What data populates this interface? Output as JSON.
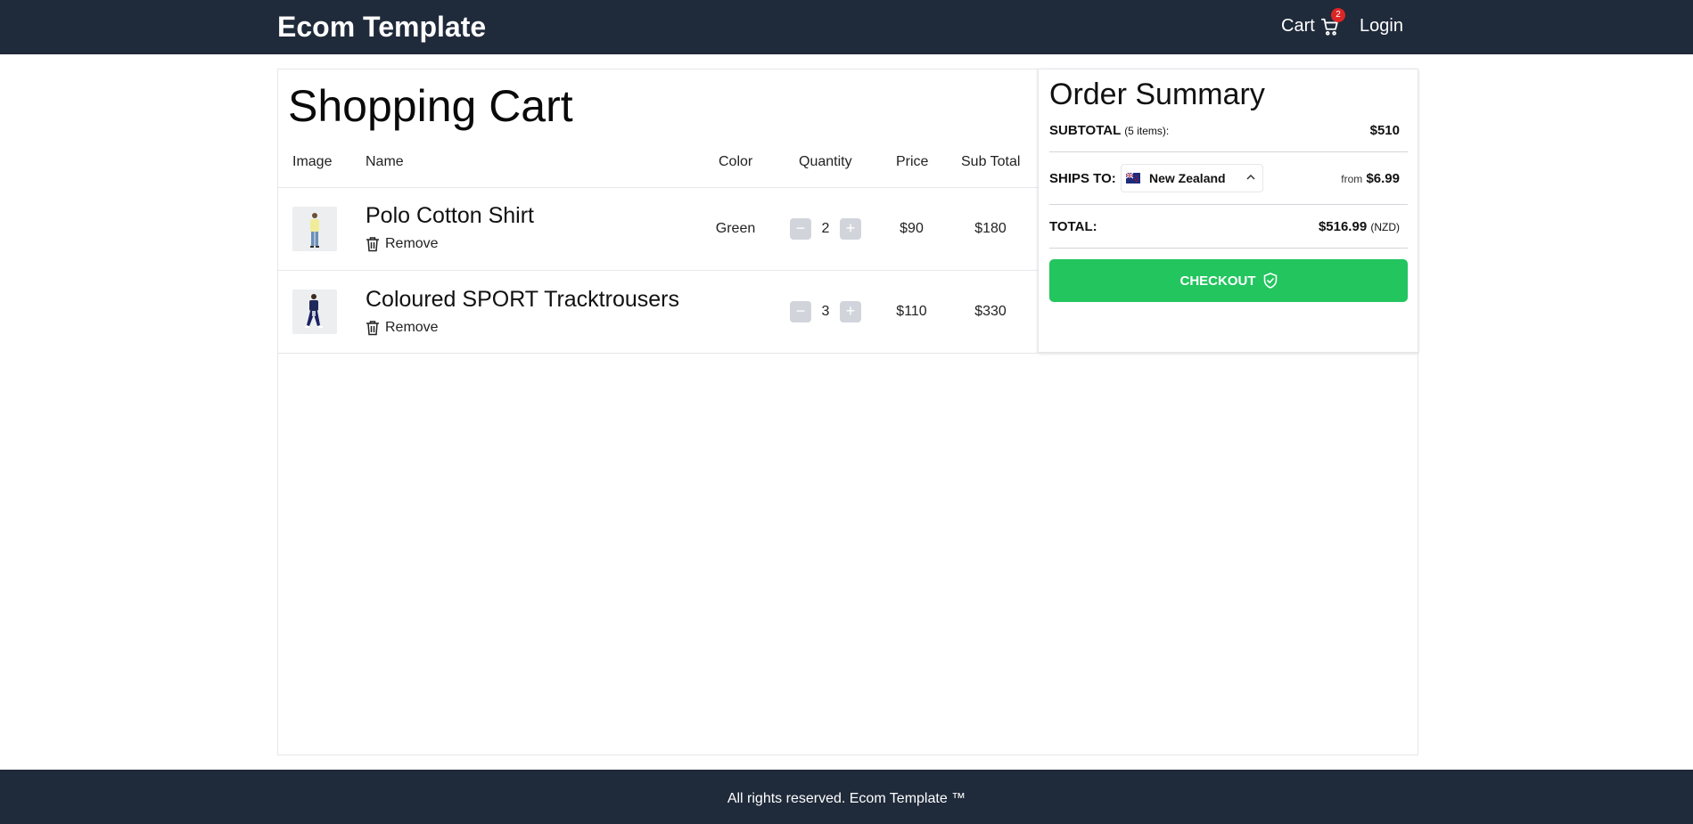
{
  "header": {
    "brand": "Ecom Template",
    "cart_label": "Cart",
    "cart_count": "2",
    "login_label": "Login"
  },
  "cart": {
    "title": "Shopping Cart",
    "columns": [
      "Image",
      "Name",
      "Color",
      "Quantity",
      "Price",
      "Sub Total"
    ],
    "remove_label": "Remove",
    "items": [
      {
        "name": "Polo Cotton Shirt",
        "color": "Green",
        "quantity": "2",
        "price": "$90",
        "subtotal": "$180"
      },
      {
        "name": "Coloured SPORT Tracktrousers",
        "color": "",
        "quantity": "3",
        "price": "$110",
        "subtotal": "$330"
      }
    ]
  },
  "summary": {
    "title": "Order Summary",
    "subtotal_label": "SUBTOTAL",
    "subtotal_items": "(5 items):",
    "subtotal_value": "$510",
    "ships_label": "SHIPS TO:",
    "country": "New Zealand",
    "from_label": "from",
    "shipping_value": "$6.99",
    "total_label": "TOTAL:",
    "total_value": "$516.99",
    "total_currency": "(NZD)",
    "checkout_label": "CHECKOUT"
  },
  "footer": {
    "text": "All rights reserved. Ecom Template ™"
  },
  "colors": {
    "nav_bg": "#1f2a3a",
    "checkout_green": "#22c55e",
    "badge_red": "#dc2626"
  }
}
